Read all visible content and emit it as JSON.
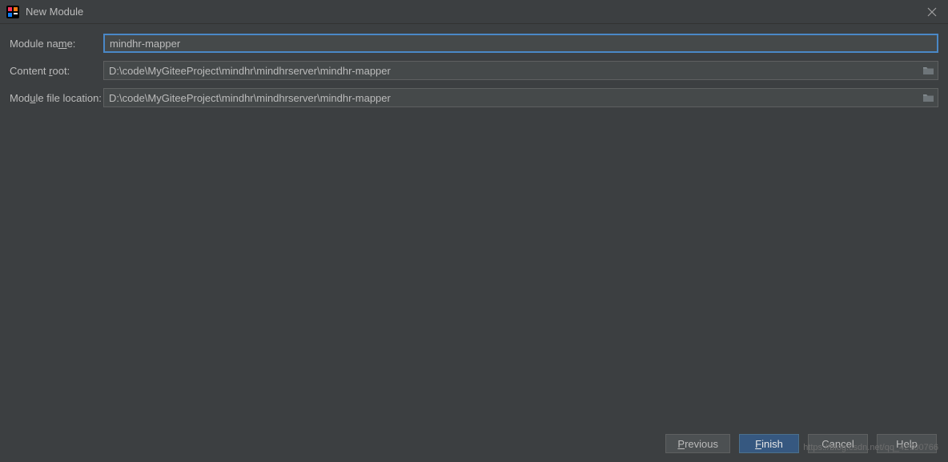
{
  "titlebar": {
    "title": "New Module"
  },
  "form": {
    "module_name": {
      "label_pre": "Module na",
      "label_u": "m",
      "label_post": "e:",
      "value": "mindhr-mapper"
    },
    "content_root": {
      "label_pre": "Content ",
      "label_u": "r",
      "label_post": "oot:",
      "value": "D:\\code\\MyGiteeProject\\mindhr\\mindhrserver\\mindhr-mapper"
    },
    "module_file_location": {
      "label_pre": "Mod",
      "label_u": "u",
      "label_post": "le file location:",
      "value": "D:\\code\\MyGiteeProject\\mindhr\\mindhrserver\\mindhr-mapper"
    }
  },
  "buttons": {
    "previous_u": "P",
    "previous_post": "revious",
    "finish_u": "F",
    "finish_post": "inish",
    "cancel": "Cancel",
    "help": "Help"
  },
  "watermark": "https://blog.csdn.net/qq_42700766"
}
